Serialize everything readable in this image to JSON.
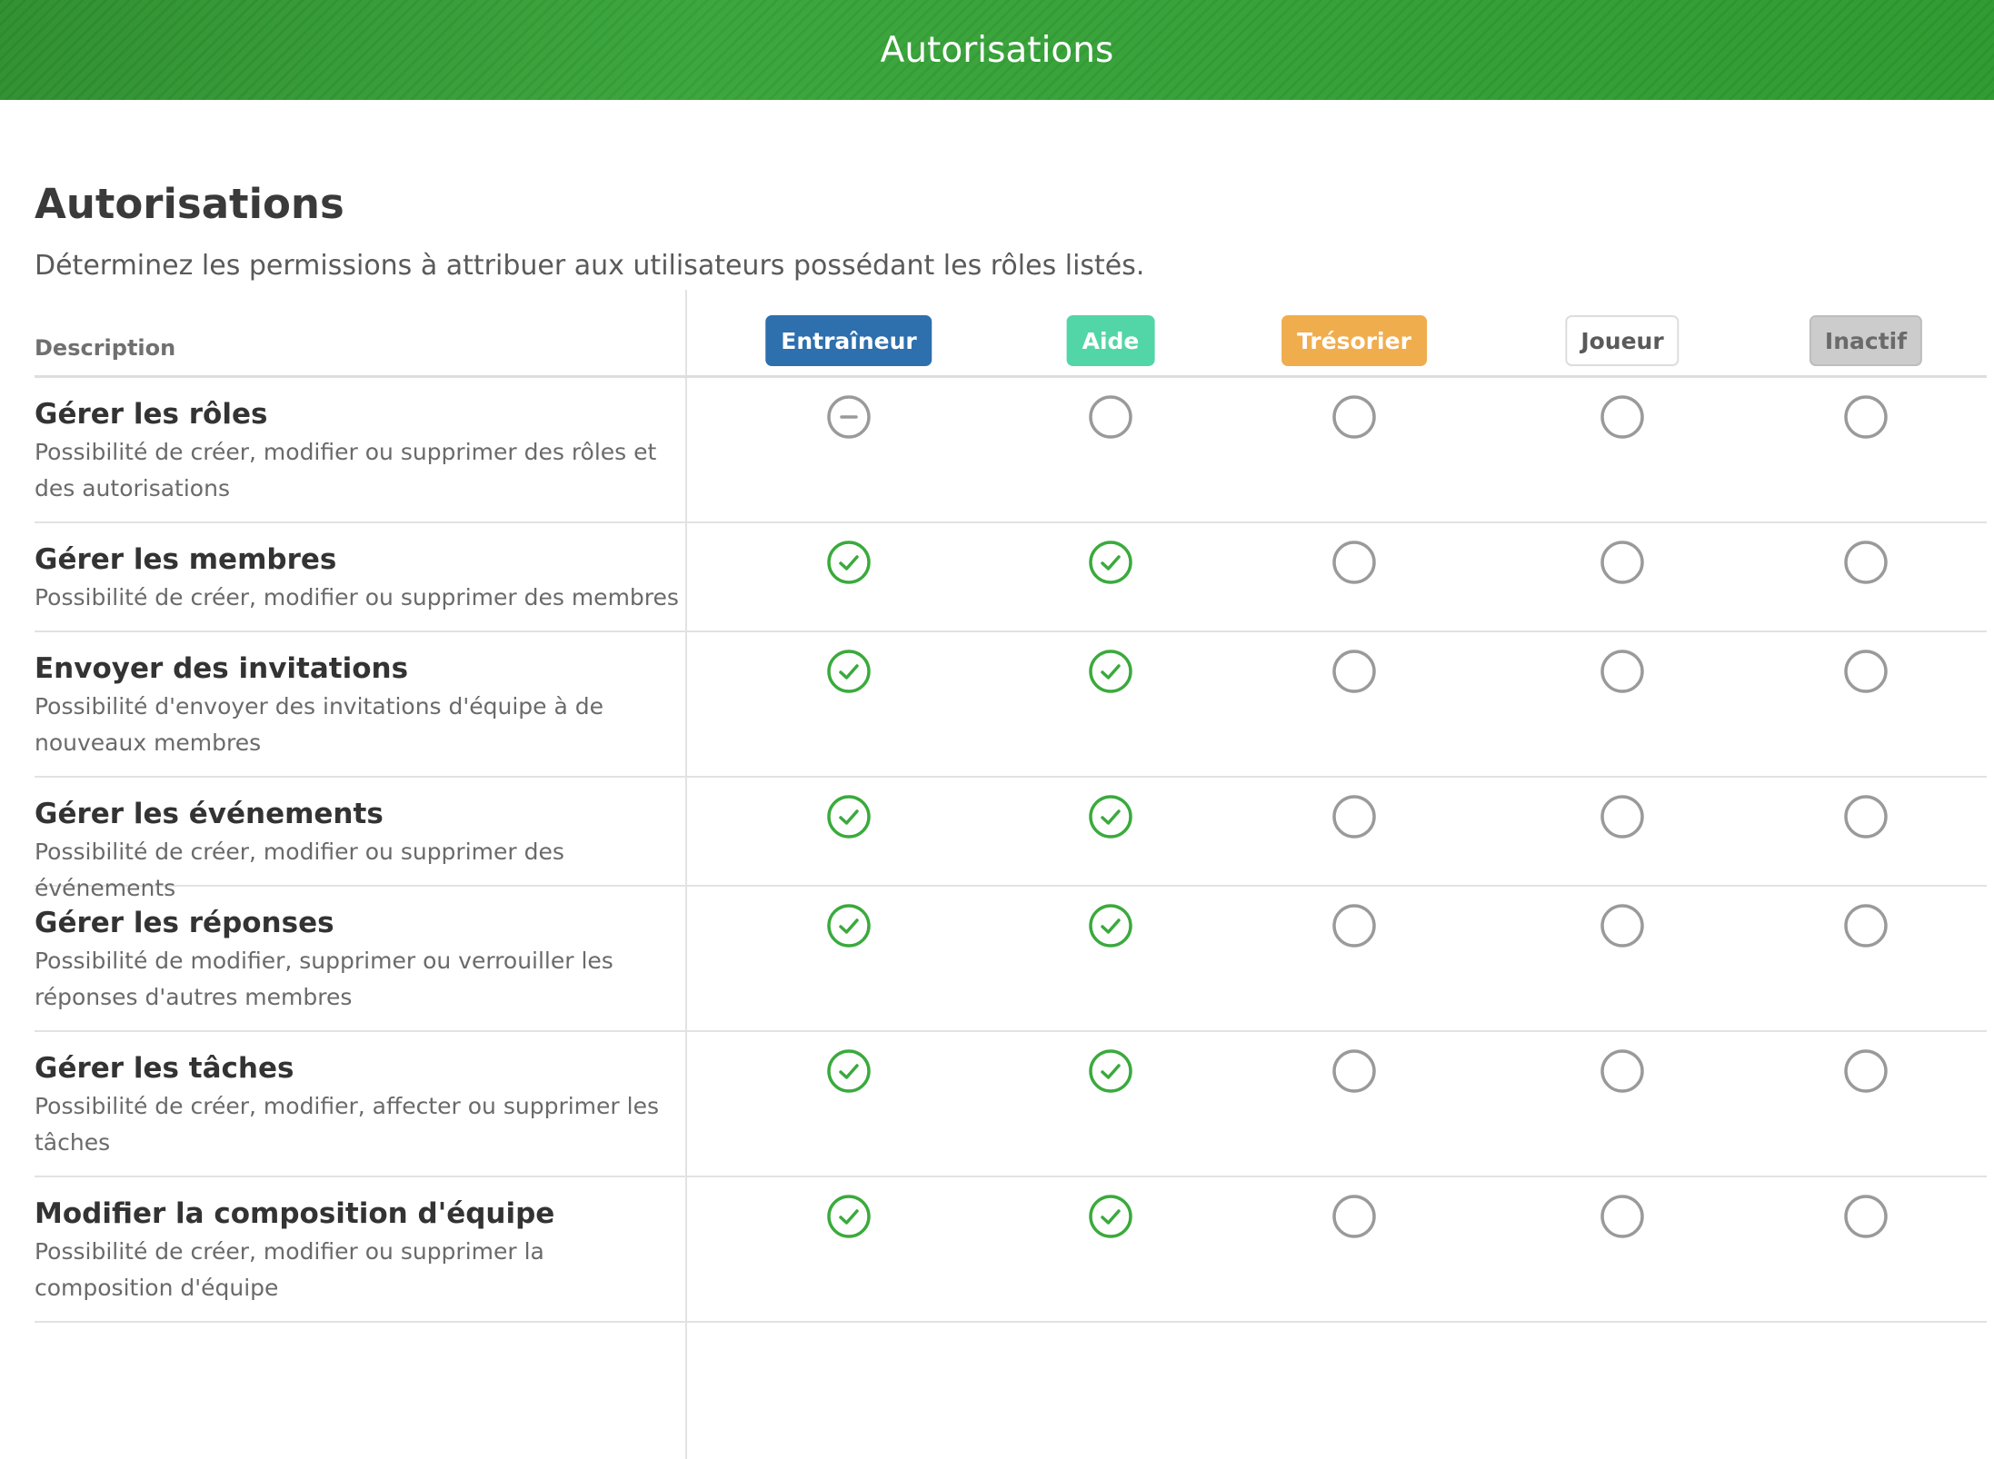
{
  "header": {
    "title": "Autorisations"
  },
  "page": {
    "title": "Autorisations",
    "subtitle": "Déterminez les permissions à attribuer aux utilisateurs possédant les rôles listés."
  },
  "table": {
    "description_header": "Description",
    "roles": [
      {
        "label": "Entraîneur",
        "bg": "#2e6fad",
        "fg": "#ffffff",
        "border": "#2e6fad"
      },
      {
        "label": "Aide",
        "bg": "#52d6a7",
        "fg": "#ffffff",
        "border": "#52d6a7"
      },
      {
        "label": "Trésorier",
        "bg": "#f0ad4e",
        "fg": "#ffffff",
        "border": "#f0ad4e"
      },
      {
        "label": "Joueur",
        "bg": "#ffffff",
        "fg": "#5a5a5a",
        "border": "#dddddd"
      },
      {
        "label": "Inactif",
        "bg": "#cccccc",
        "fg": "#6a6a6a",
        "border": "#bdbdbd"
      }
    ],
    "rows": [
      {
        "title": "Gérer les rôles",
        "description": "Possibilité de créer, modifier ou supprimer des rôles et des autorisations",
        "states": [
          "partial",
          "off",
          "off",
          "off",
          "off"
        ]
      },
      {
        "title": "Gérer les membres",
        "description": "Possibilité de créer, modifier ou supprimer des membres",
        "states": [
          "on",
          "on",
          "off",
          "off",
          "off"
        ]
      },
      {
        "title": "Envoyer des invitations",
        "description": "Possibilité d'envoyer des invitations d'équipe à de nouveaux membres",
        "states": [
          "on",
          "on",
          "off",
          "off",
          "off"
        ]
      },
      {
        "title": "Gérer les événements",
        "description": "Possibilité de créer, modifier ou supprimer des événements",
        "states": [
          "on",
          "on",
          "off",
          "off",
          "off"
        ]
      },
      {
        "title": "Gérer les réponses",
        "description": "Possibilité de modifier, supprimer ou verrouiller les réponses d'autres membres",
        "states": [
          "on",
          "on",
          "off",
          "off",
          "off"
        ]
      },
      {
        "title": "Gérer les tâches",
        "description": "Possibilité de créer, modifier, affecter ou supprimer les tâches",
        "states": [
          "on",
          "on",
          "off",
          "off",
          "off"
        ]
      },
      {
        "title": "Modifier la composition d'équipe",
        "description": "Possibilité de créer, modifier ou supprimer la composition d'équipe",
        "states": [
          "on",
          "on",
          "off",
          "off",
          "off"
        ]
      }
    ],
    "colors": {
      "check": "#3aaa3c",
      "empty": "#9a9a9a"
    }
  }
}
